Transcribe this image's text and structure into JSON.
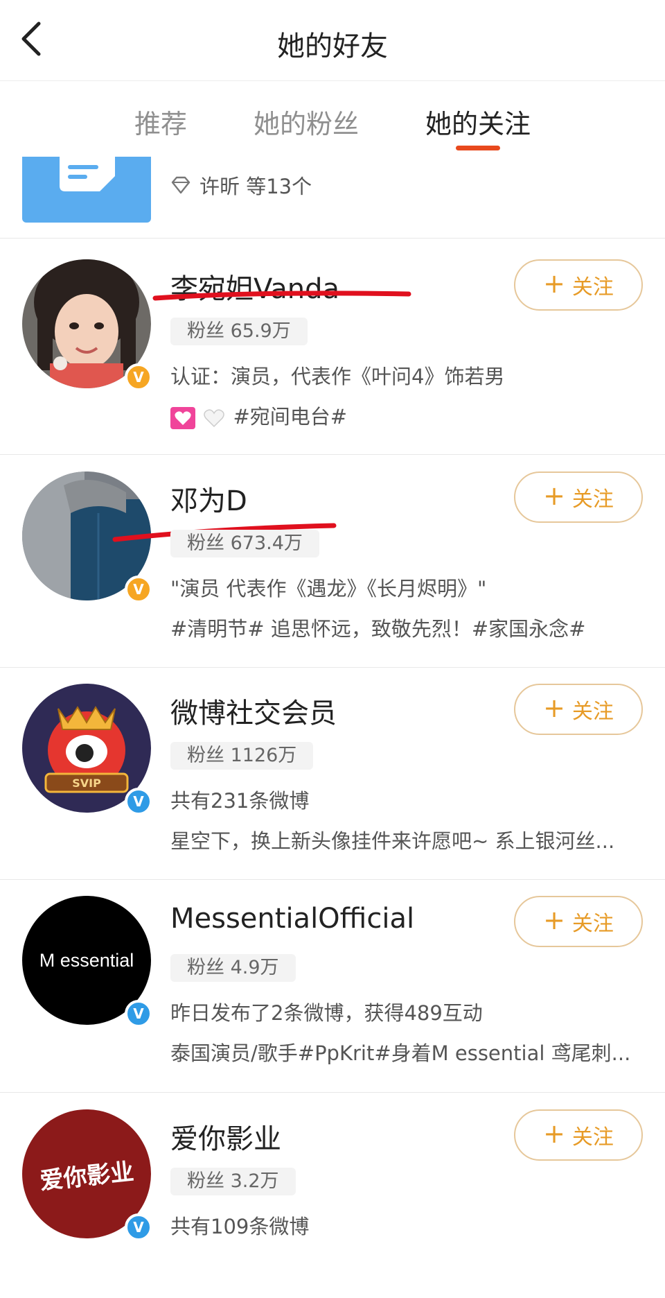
{
  "header": {
    "title": "她的好友",
    "back_icon": "chevron-left-icon"
  },
  "tabs": [
    {
      "label": "推荐",
      "active": false
    },
    {
      "label": "她的粉丝",
      "active": false
    },
    {
      "label": "她的关注",
      "active": true
    }
  ],
  "accent_color": "#e8491d",
  "group": {
    "members_text": "许昕 等13个",
    "icon": "diamond-icon"
  },
  "follow_label": "关注",
  "users": [
    {
      "name": "李宛妲Vanda",
      "fans": "粉丝 65.9万",
      "line1": "认证：演员，代表作《叶问4》饰若男",
      "line2": "#宛间电台#",
      "badge": "gold",
      "underlined": true
    },
    {
      "name": "邓为D",
      "fans": "粉丝 673.4万",
      "line1": "\"演员 代表作《遇龙》《长月烬明》\"",
      "line2": "#清明节# 追思怀远，致敬先烈！#家国永念#",
      "badge": "gold",
      "underlined": true
    },
    {
      "name": "微博社交会员",
      "fans": "粉丝 1126万",
      "line1": "共有231条微博",
      "line2": "星空下，换上新头像挂件来许愿吧~ 系上银河丝...",
      "badge": "blue",
      "underlined": false
    },
    {
      "name": "MessentialOfficial",
      "fans": "粉丝 4.9万",
      "line1": "昨日发布了2条微博，获得489互动",
      "line2": "泰国演员/歌手#PpKrit#身着M essential 鸢尾刺...",
      "badge": "blue",
      "underlined": false,
      "avatar_text": "M essential"
    },
    {
      "name": "爱你影业",
      "fans": "粉丝 3.2万",
      "line1": "共有109条微博",
      "line2": "",
      "badge": "blue",
      "underlined": false,
      "avatar_text": "爱你影业"
    }
  ]
}
